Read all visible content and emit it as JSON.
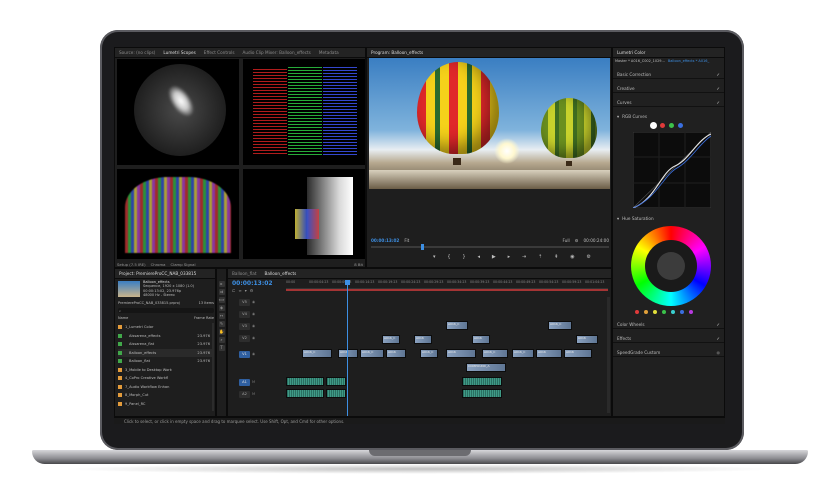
{
  "scopes_panel": {
    "tabs": [
      "Source: (no clips)",
      "Lumetri Scopes",
      "Effect Controls",
      "Audio Clip Mixer: Balloon_effects",
      "Metadata"
    ],
    "active_tab": 1,
    "footer": {
      "clamp_label": "8 Bit",
      "setup_label": "Setup (7.5 IRE)",
      "chroma_label": "Chroma",
      "clamp_signal_label": "Clamp Signal"
    }
  },
  "program_monitor": {
    "title": "Program: Balloon_effects",
    "timecode": "00:00:13:02",
    "fit_label": "Fit",
    "quality_label": "Full",
    "end_timecode": "00:00:24:00"
  },
  "lumetri_panel": {
    "tab_title": "Lumetri Color",
    "breadcrumb_master": "Master * A016_C002_1029...",
    "breadcrumb_clip": "Balloon_effects * A016_",
    "sections": [
      {
        "label": "Basic Correction",
        "checked": true
      },
      {
        "label": "Creative",
        "checked": true
      },
      {
        "label": "Curves",
        "checked": true
      }
    ],
    "rgb_curves_label": "RGB Curves",
    "hue_saturation_label": "Hue Saturation",
    "bottom_sections": [
      {
        "label": "Color Wheels",
        "checked": true
      },
      {
        "label": "Effects",
        "checked": true
      },
      {
        "label": "SpeedGrade Custom",
        "checked": false
      }
    ],
    "curve_dot_colors": [
      "#ffffff",
      "#e03a3a",
      "#3cc24a",
      "#3a6fe0"
    ]
  },
  "project_panel": {
    "title": "Project: PremiereProCC_NAB_033815",
    "clip_name": "Balloon_effects",
    "clip_meta1": "Sequence, 1920 x 1080 (1.0)",
    "clip_meta2": "00:00:13:02, 23.976p",
    "clip_meta3": "48000 Hz - Stereo",
    "project_file": "PremiereProCC_NAB_033815.prproj",
    "items_count": "13 Items",
    "name_header": "Name",
    "rate_header": "Frame Rate",
    "items": [
      {
        "name": "1_Lumetri Color",
        "rate": "",
        "color": "#e39b3b"
      },
      {
        "name": "Aissarena_effects",
        "rate": "23.976",
        "color": "#41a84a"
      },
      {
        "name": "Aissarena_flat",
        "rate": "23.976",
        "color": "#41a84a"
      },
      {
        "name": "Balloon_effects",
        "rate": "23.976",
        "color": "#41a84a"
      },
      {
        "name": "Balloon_flat",
        "rate": "23.976",
        "color": "#41a84a"
      },
      {
        "name": "3_Mobile to Desktop Work",
        "rate": "",
        "color": "#e39b3b"
      },
      {
        "name": "4_CoPro Creative Workfl",
        "rate": "",
        "color": "#e39b3b"
      },
      {
        "name": "7_Audio Workflow Enhan",
        "rate": "",
        "color": "#e39b3b"
      },
      {
        "name": "8_Morph_Cut",
        "rate": "",
        "color": "#e39b3b"
      },
      {
        "name": "9_Panel_RC",
        "rate": "",
        "color": "#e39b3b"
      }
    ]
  },
  "timeline": {
    "tabs": [
      "Balloon_flat",
      "Balloon_effects"
    ],
    "active_tab": 1,
    "timecode": "00:00:13:02",
    "ruler": [
      "00:00",
      "00:00:04:23",
      "00:00:09:23",
      "00:00:14:23",
      "00:00:19:23",
      "00:00:24:23",
      "00:00:29:23",
      "00:00:34:23",
      "00:00:39:23",
      "00:00:44:23",
      "00:00:49:23",
      "00:00:54:23",
      "00:00:59:23",
      "00:01:04:23"
    ],
    "tracks": [
      "V5",
      "V4",
      "V3",
      "V2",
      "V1",
      "A1",
      "A2"
    ],
    "video_clips": [
      "A016_C",
      "A016",
      "A016_C",
      "A016",
      "A016_C",
      "A016",
      "A016_C",
      "A016",
      "A016_C",
      "A016",
      "A016_C",
      "A016",
      "A016_C",
      "A016_C",
      "A016",
      "A016",
      "COMPOUND_A"
    ]
  },
  "status_bar": {
    "text": "Click to select, or click in empty space and drag to marquee select. Use Shift, Opt, and Cmd for other options."
  }
}
